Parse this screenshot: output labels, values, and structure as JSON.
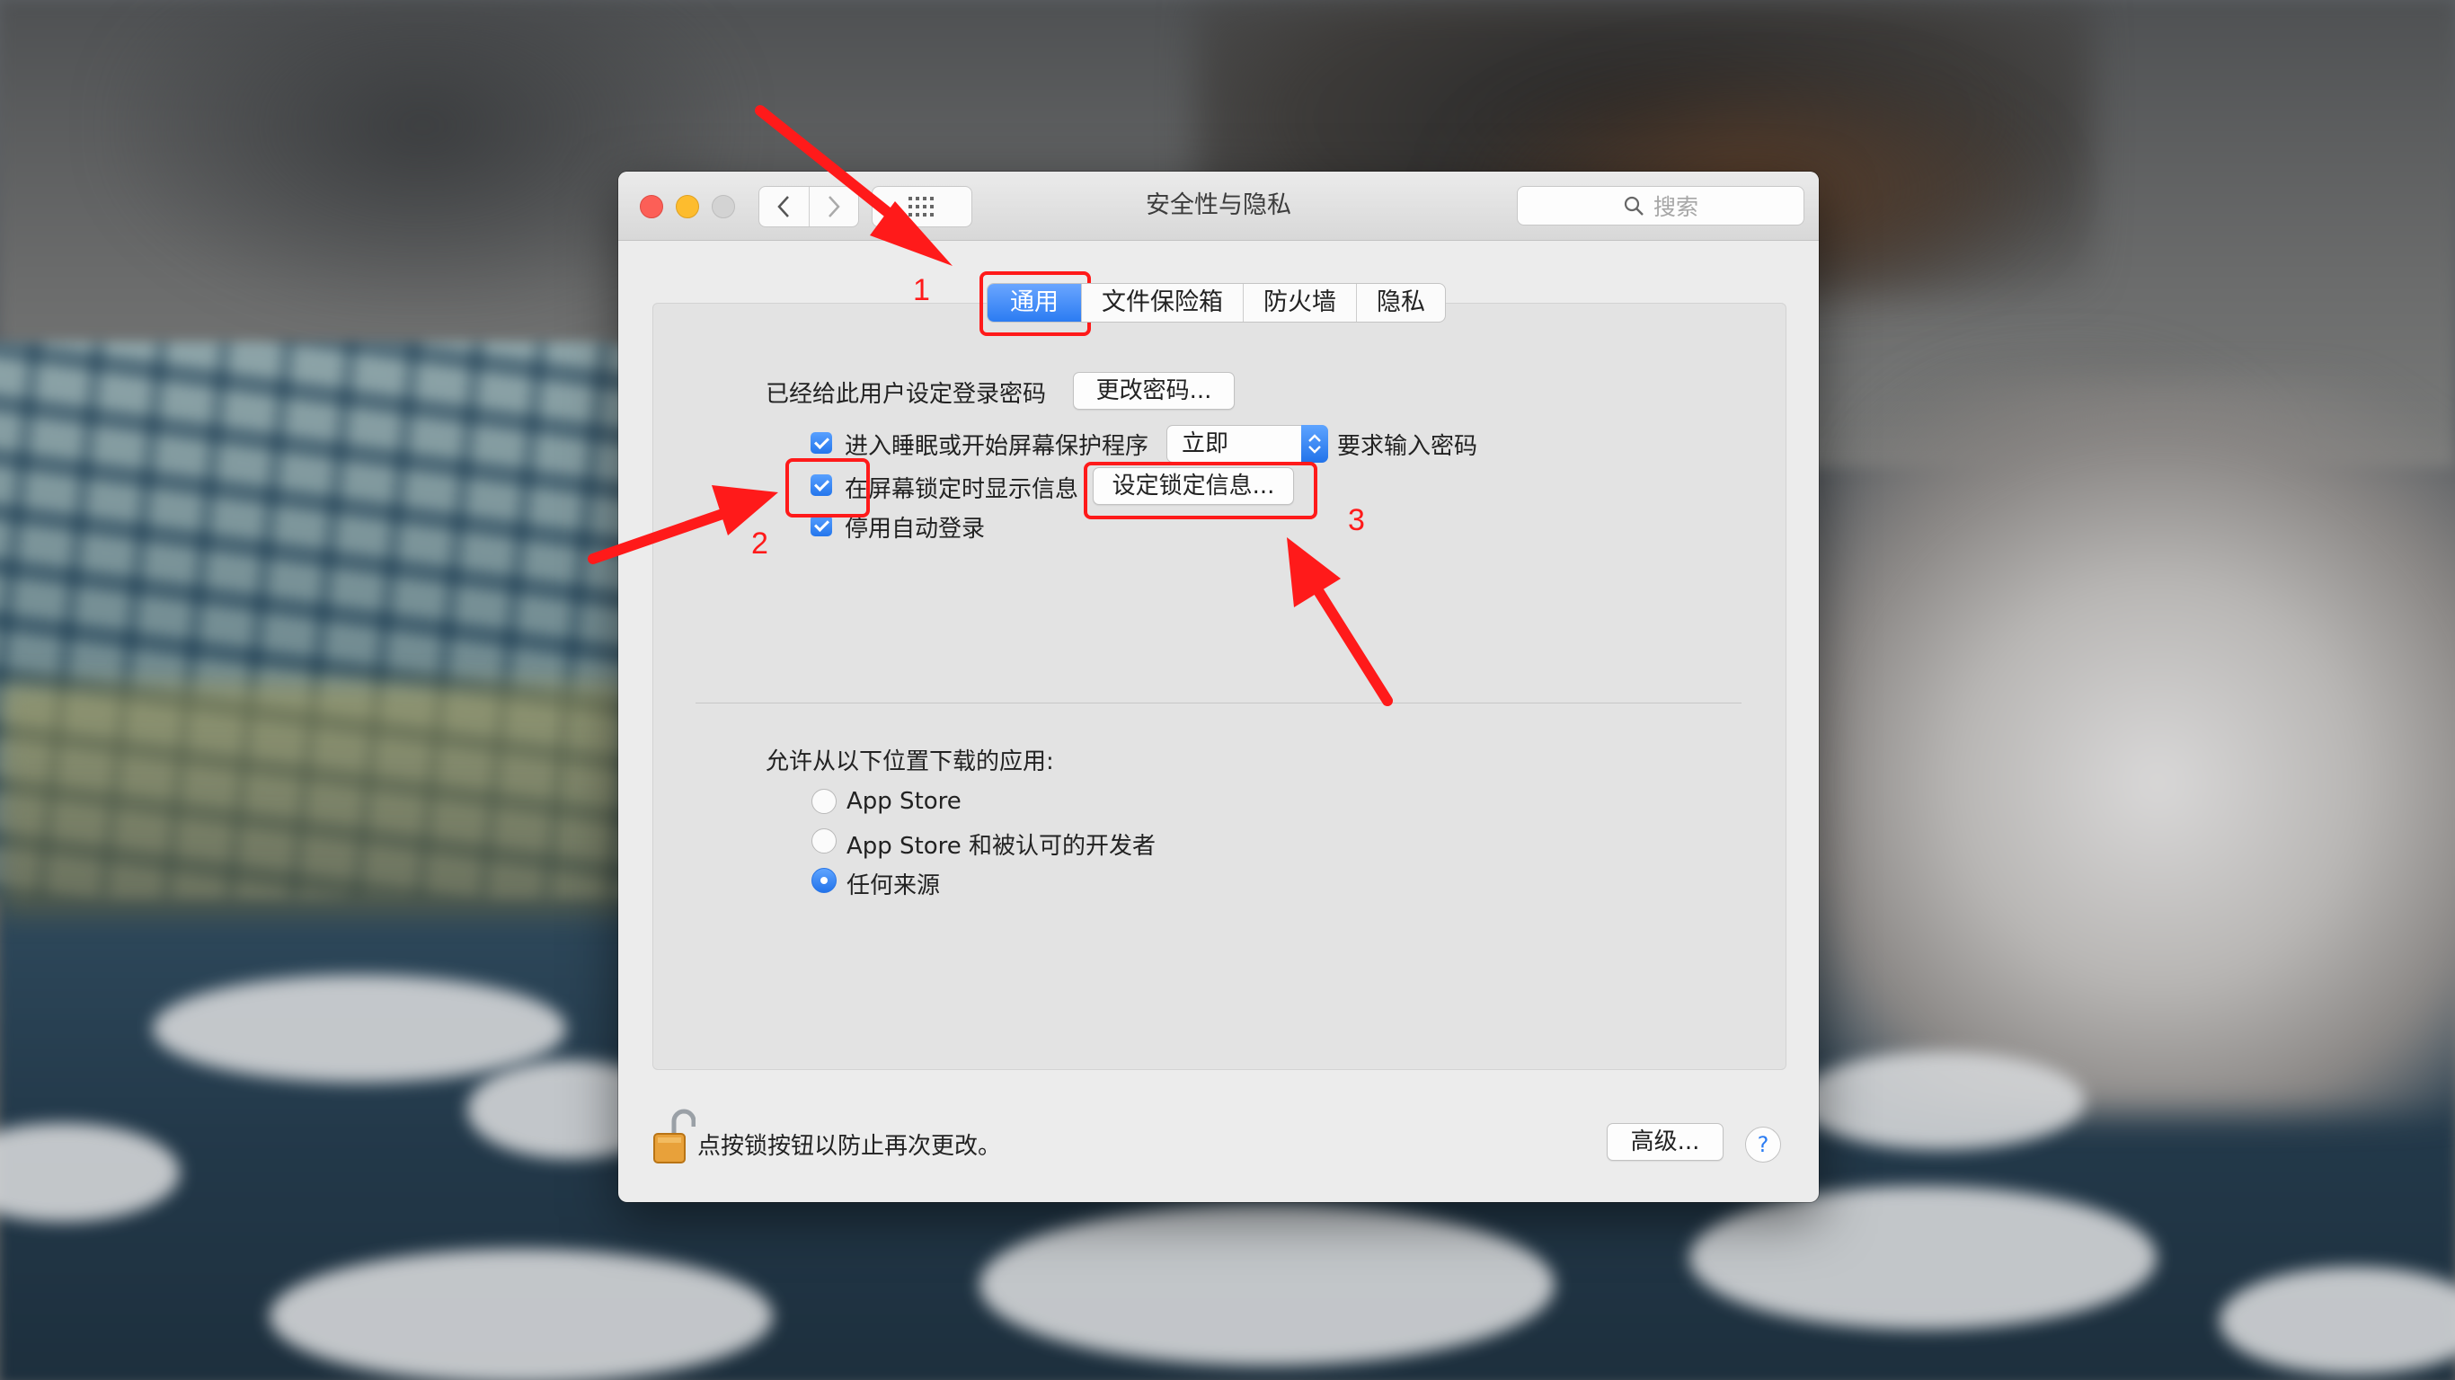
{
  "window": {
    "title": "安全性与隐私",
    "search_placeholder": "搜索"
  },
  "tabs": [
    {
      "label": "通用",
      "active": true
    },
    {
      "label": "文件保险箱",
      "active": false
    },
    {
      "label": "防火墙",
      "active": false
    },
    {
      "label": "隐私",
      "active": false
    }
  ],
  "general": {
    "password_label": "已经给此用户设定登录密码",
    "change_password_button": "更改密码...",
    "require_password": {
      "checked": true,
      "label": "进入睡眠或开始屏幕保护程序",
      "select_value": "立即",
      "suffix": "要求输入密码"
    },
    "show_message": {
      "checked": true,
      "label": "在屏幕锁定时显示信息",
      "button": "设定锁定信息..."
    },
    "disable_auto_login": {
      "checked": true,
      "label": "停用自动登录"
    }
  },
  "downloads": {
    "heading": "允许从以下位置下载的应用:",
    "options": [
      {
        "label": "App Store",
        "selected": false
      },
      {
        "label": "App Store 和被认可的开发者",
        "selected": false
      },
      {
        "label": "任何来源",
        "selected": true
      }
    ]
  },
  "footer": {
    "lock_text": "点按锁按钮以防止再次更改。",
    "advanced_button": "高级...",
    "help_label": "?"
  },
  "annotations": {
    "numbers": [
      "1",
      "2",
      "3"
    ],
    "color": "#ff1a1a"
  },
  "colors": {
    "accent": "#2b7cf2",
    "close": "#fc5f57",
    "minimize": "#fdbc2e"
  }
}
